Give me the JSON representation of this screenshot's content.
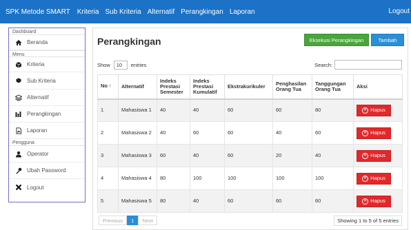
{
  "navbar": {
    "brand": "SPK Metode SMART",
    "links": [
      "Kriteria",
      "Sub Kriteria",
      "Alternatif",
      "Perangkingan",
      "Laporan"
    ],
    "logout": "Logout"
  },
  "sidebar": {
    "sections": [
      "Dashboard",
      "Menu",
      "Pengguna"
    ],
    "items": [
      {
        "label": "Beranda",
        "icon": "home-icon"
      },
      {
        "label": "Kriteria",
        "icon": "cube-icon"
      },
      {
        "label": "Sub Kriteria",
        "icon": "cubes-icon"
      },
      {
        "label": "Alternatif",
        "icon": "layers-icon"
      },
      {
        "label": "Perangkingan",
        "icon": "chart-bar-icon"
      },
      {
        "label": "Laporan",
        "icon": "file-pdf-icon"
      },
      {
        "label": "Operator",
        "icon": "user-icon"
      },
      {
        "label": "Ubah Password",
        "icon": "key-icon"
      },
      {
        "label": "Logout",
        "icon": "close-icon"
      }
    ]
  },
  "main": {
    "title": "Perangkingan",
    "exec_button": "Eksekusi Perangkingan",
    "add_button": "Tambah",
    "show_prefix": "Show",
    "show_value": "10",
    "show_suffix": "entries",
    "search_label": "Search:",
    "columns": [
      "No",
      "Alternatif",
      "Indeks Prestasi Semester",
      "Indeks Prestasi Kumulatif",
      "Ekstrakurikuler",
      "Penghasilan Orang Tua",
      "Tanggungan Orang Tua",
      "Aksi"
    ],
    "sort_indicator": "↑",
    "delete_label": "Hapus",
    "rows": [
      {
        "no": "1",
        "alt": "Mahasiswa 1",
        "ips": "40",
        "ipk": "40",
        "eks": "60",
        "peng": "60",
        "tang": "80"
      },
      {
        "no": "2",
        "alt": "Mahasiswa 2",
        "ips": "40",
        "ipk": "60",
        "eks": "60",
        "peng": "40",
        "tang": "60"
      },
      {
        "no": "3",
        "alt": "Mahasiswa 3",
        "ips": "60",
        "ipk": "40",
        "eks": "60",
        "peng": "20",
        "tang": "40"
      },
      {
        "no": "4",
        "alt": "Mahasiswa 4",
        "ips": "80",
        "ipk": "100",
        "eks": "100",
        "peng": "100",
        "tang": "100"
      },
      {
        "no": "5",
        "alt": "Mahasiswa 5",
        "ips": "80",
        "ipk": "40",
        "eks": "60",
        "peng": "60",
        "tang": "60"
      }
    ],
    "pager": {
      "previous": "Previous",
      "page": "1",
      "next": "Next"
    },
    "info": "Showing 1 to 5 of 5 entries"
  },
  "colors": {
    "navbar": "#1b72c7",
    "exec": "#4aa53c",
    "add": "#2a8fd6",
    "delete": "#e0292b",
    "sidebar_border": "#6f6fd1"
  }
}
